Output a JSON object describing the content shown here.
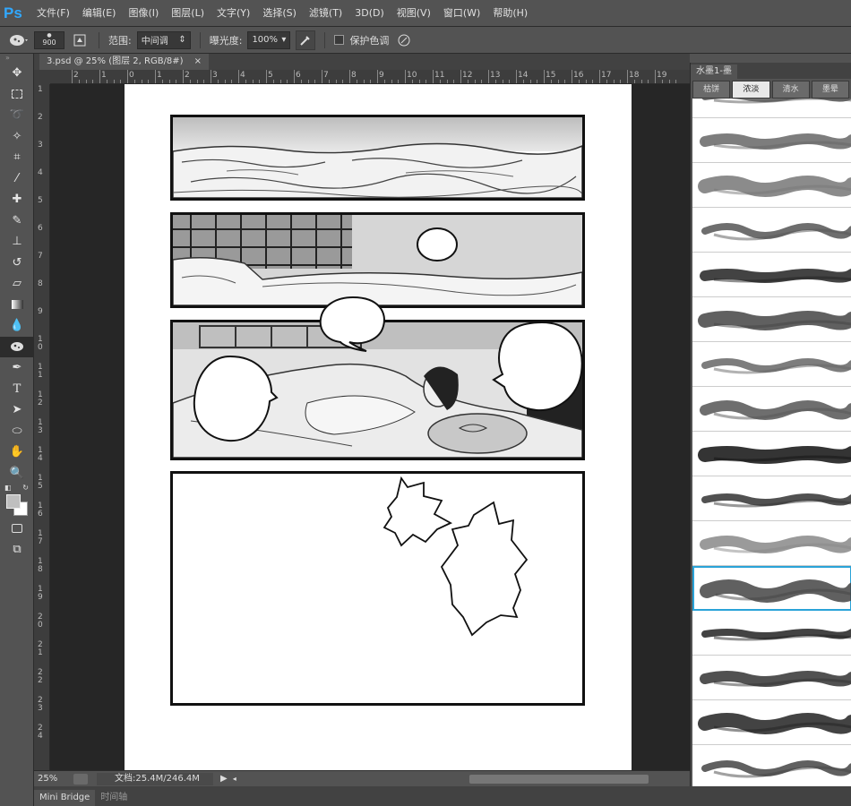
{
  "app": {
    "logo": "Ps"
  },
  "menu": [
    "文件(F)",
    "编辑(E)",
    "图像(I)",
    "图层(L)",
    "文字(Y)",
    "选择(S)",
    "滤镜(T)",
    "3D(D)",
    "视图(V)",
    "窗口(W)",
    "帮助(H)"
  ],
  "options": {
    "brush_size": "900",
    "range_label": "范围:",
    "range_value": "中间调",
    "exposure_label": "曝光度:",
    "exposure_value": "100%",
    "protect_tones_label": "保护色调"
  },
  "document": {
    "tab_title": "3.psd @ 25% (图层 2, RGB/8#)",
    "close": "×"
  },
  "rulers": {
    "h": [
      "2",
      "1",
      "0",
      "1",
      "2",
      "3",
      "4",
      "5",
      "6",
      "7",
      "8",
      "9",
      "10",
      "11",
      "12",
      "13",
      "14",
      "15",
      "16",
      "17",
      "18",
      "19"
    ],
    "v": [
      "1",
      "2",
      "3",
      "4",
      "5",
      "6",
      "7",
      "8",
      "9",
      "10",
      "11",
      "12",
      "13",
      "14",
      "15",
      "16",
      "17",
      "18",
      "19",
      "20",
      "21",
      "22",
      "23",
      "24"
    ]
  },
  "status": {
    "zoom": "25%",
    "doc_info": "文档:25.4M/246.4M"
  },
  "bottom_tabs": [
    "Mini Bridge",
    "时间轴"
  ],
  "brush_panel": {
    "title": "水墨1-墨",
    "tabs": [
      "枯饼",
      "浓淡",
      "清水",
      "墨晕"
    ],
    "active_tab": 1,
    "selected_stroke": 11
  }
}
